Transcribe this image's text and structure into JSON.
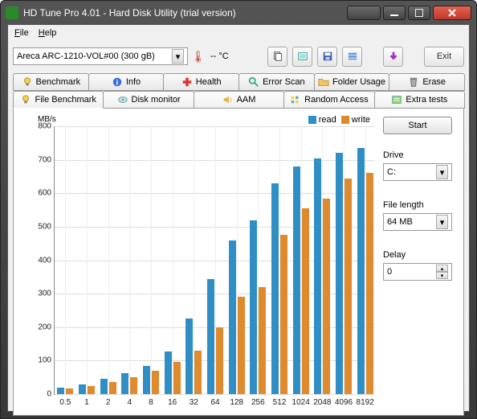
{
  "window": {
    "title": "HD Tune Pro 4.01 - Hard Disk Utility (trial version)"
  },
  "menu": {
    "file": "File",
    "help": "Help"
  },
  "toolbar": {
    "drive": "Areca   ARC-1210-VOL#00  (300 gB)",
    "temp": "-- °C",
    "exit": "Exit"
  },
  "tabs_top": [
    {
      "label": "Benchmark",
      "icon": "bulb"
    },
    {
      "label": "Info",
      "icon": "info"
    },
    {
      "label": "Health",
      "icon": "health"
    },
    {
      "label": "Error Scan",
      "icon": "search"
    },
    {
      "label": "Folder Usage",
      "icon": "folder"
    },
    {
      "label": "Erase",
      "icon": "trash"
    }
  ],
  "tabs_bottom": [
    {
      "label": "File Benchmark",
      "icon": "bulb",
      "active": true
    },
    {
      "label": "Disk monitor",
      "icon": "disk"
    },
    {
      "label": "AAM",
      "icon": "speaker"
    },
    {
      "label": "Random Access",
      "icon": "random"
    },
    {
      "label": "Extra tests",
      "icon": "extra"
    }
  ],
  "side": {
    "start": "Start",
    "drive_label": "Drive",
    "drive_value": "C:",
    "filelen_label": "File length",
    "filelen_value": "64 MB",
    "delay_label": "Delay",
    "delay_value": "0"
  },
  "chart_data": {
    "type": "bar",
    "ylabel": "MB/s",
    "ylim": [
      0,
      800
    ],
    "yticks": [
      0,
      100,
      200,
      300,
      400,
      500,
      600,
      700,
      800
    ],
    "categories": [
      "0.5",
      "1",
      "2",
      "4",
      "8",
      "16",
      "32",
      "64",
      "128",
      "256",
      "512",
      "1024",
      "2048",
      "4096",
      "8192"
    ],
    "series": [
      {
        "name": "read",
        "color": "#2f8fc5",
        "values": [
          20,
          28,
          45,
          63,
          85,
          128,
          225,
          343,
          460,
          520,
          630,
          680,
          705,
          720,
          735
        ]
      },
      {
        "name": "write",
        "color": "#e08a2e",
        "values": [
          18,
          24,
          35,
          50,
          70,
          95,
          130,
          200,
          290,
          320,
          475,
          555,
          585,
          645,
          660
        ]
      }
    ]
  }
}
